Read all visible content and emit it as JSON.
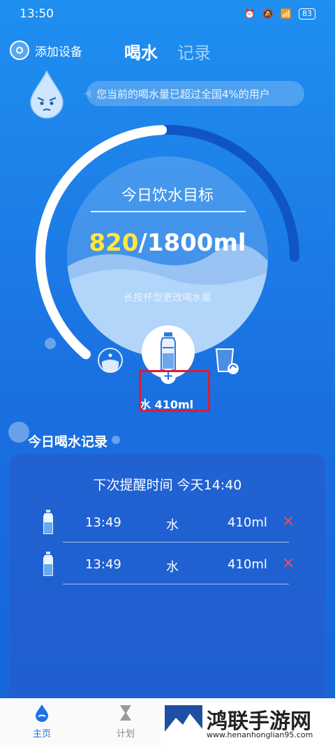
{
  "status_bar": {
    "time": "13:50",
    "icons": [
      "alarm-icon",
      "mute-icon",
      "wifi-icon",
      "hd-icon",
      "signal-icon"
    ],
    "battery": "83"
  },
  "header": {
    "add_device": "添加设备",
    "tabs": [
      {
        "label": "喝水"
      },
      {
        "label": "记录"
      }
    ]
  },
  "bubble": {
    "text": "您当前的喝水量已超过全国4%的用户"
  },
  "goal": {
    "title": "今日饮水目标",
    "current": "820",
    "target": "/1800ml",
    "hint": "长按杯型更改喝水量",
    "progress_fraction": 0.46
  },
  "cup": {
    "label": "水 410ml",
    "plus": "+"
  },
  "records": {
    "title": "今日喝水记录",
    "next_reminder": "下次提醒时间 今天14:40",
    "rows": [
      {
        "time": "13:49",
        "kind": "水",
        "amount": "410ml",
        "delete": "×"
      },
      {
        "time": "13:49",
        "kind": "水",
        "amount": "410ml",
        "delete": "×"
      }
    ]
  },
  "bottom_nav": {
    "items": [
      {
        "label": "主页"
      },
      {
        "label": "计划"
      }
    ]
  },
  "watermark": {
    "title": "鸿联手游网",
    "url": "www.henanhonglian95.com"
  },
  "colors": {
    "accent": "#1a73e8",
    "current_value": "#ffe83a",
    "delete": "#ff4a4a",
    "highlight": "#e21b2e"
  }
}
